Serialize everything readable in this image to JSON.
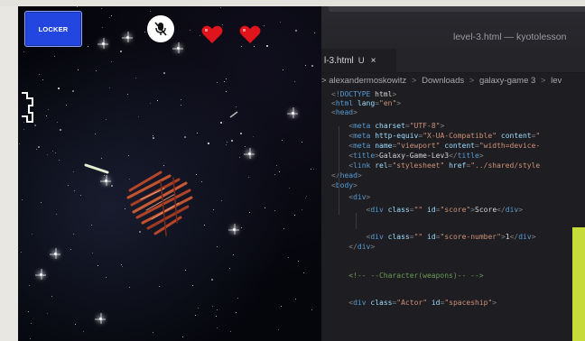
{
  "game": {
    "locker_label": "LOCKER",
    "mic_icon": "microphone-muted-icon",
    "lives": 2,
    "heart_color": "#e0141c",
    "locker_color": "#2346e0"
  },
  "editor": {
    "window_title": "level-3.html — kyotolesson",
    "tab": {
      "label": "l-3.html",
      "status": "U",
      "close": "×"
    },
    "breadcrumb": [
      ">",
      "alexandermoskowitz",
      ">",
      "Downloads",
      ">",
      "galaxy-game 3",
      ">",
      "lev"
    ],
    "code_lines": [
      [
        {
          "t": "punc",
          "v": "<!"
        },
        {
          "t": "tag",
          "v": "DOCTYPE"
        },
        {
          "t": "text",
          "v": " html"
        },
        {
          "t": "punc",
          "v": ">"
        }
      ],
      [
        {
          "t": "punc",
          "v": "<"
        },
        {
          "t": "tag",
          "v": "html"
        },
        {
          "t": "text",
          "v": " "
        },
        {
          "t": "attr",
          "v": "lang"
        },
        {
          "t": "punc",
          "v": "="
        },
        {
          "t": "str",
          "v": "\"en\""
        },
        {
          "t": "punc",
          "v": ">"
        }
      ],
      [
        {
          "t": "punc",
          "v": "<"
        },
        {
          "t": "tag",
          "v": "head"
        },
        {
          "t": "punc",
          "v": ">"
        }
      ],
      [
        {
          "t": "text",
          "v": "    "
        },
        {
          "t": "punc",
          "v": "<"
        },
        {
          "t": "tag",
          "v": "meta"
        },
        {
          "t": "text",
          "v": " "
        },
        {
          "t": "attr",
          "v": "charset"
        },
        {
          "t": "punc",
          "v": "="
        },
        {
          "t": "str",
          "v": "\"UTF-8\""
        },
        {
          "t": "punc",
          "v": ">"
        }
      ],
      [
        {
          "t": "text",
          "v": "    "
        },
        {
          "t": "punc",
          "v": "<"
        },
        {
          "t": "tag",
          "v": "meta"
        },
        {
          "t": "text",
          "v": " "
        },
        {
          "t": "attr",
          "v": "http-equiv"
        },
        {
          "t": "punc",
          "v": "="
        },
        {
          "t": "str",
          "v": "\"X-UA-Compatible\""
        },
        {
          "t": "text",
          "v": " "
        },
        {
          "t": "attr",
          "v": "content"
        },
        {
          "t": "punc",
          "v": "="
        },
        {
          "t": "str",
          "v": "\""
        }
      ],
      [
        {
          "t": "text",
          "v": "    "
        },
        {
          "t": "punc",
          "v": "<"
        },
        {
          "t": "tag",
          "v": "meta"
        },
        {
          "t": "text",
          "v": " "
        },
        {
          "t": "attr",
          "v": "name"
        },
        {
          "t": "punc",
          "v": "="
        },
        {
          "t": "str",
          "v": "\"viewport\""
        },
        {
          "t": "text",
          "v": " "
        },
        {
          "t": "attr",
          "v": "content"
        },
        {
          "t": "punc",
          "v": "="
        },
        {
          "t": "str",
          "v": "\"width=device-"
        }
      ],
      [
        {
          "t": "text",
          "v": "    "
        },
        {
          "t": "punc",
          "v": "<"
        },
        {
          "t": "tag",
          "v": "title"
        },
        {
          "t": "punc",
          "v": ">"
        },
        {
          "t": "text",
          "v": "Galaxy-Game-Lev3"
        },
        {
          "t": "punc",
          "v": "</"
        },
        {
          "t": "tag",
          "v": "title"
        },
        {
          "t": "punc",
          "v": ">"
        }
      ],
      [
        {
          "t": "text",
          "v": "    "
        },
        {
          "t": "punc",
          "v": "<"
        },
        {
          "t": "tag",
          "v": "link"
        },
        {
          "t": "text",
          "v": " "
        },
        {
          "t": "attr",
          "v": "rel"
        },
        {
          "t": "punc",
          "v": "="
        },
        {
          "t": "str",
          "v": "\"stylesheet\""
        },
        {
          "t": "text",
          "v": " "
        },
        {
          "t": "attr",
          "v": "href"
        },
        {
          "t": "punc",
          "v": "="
        },
        {
          "t": "str",
          "v": "\"../shared/style"
        }
      ],
      [
        {
          "t": "punc",
          "v": "</"
        },
        {
          "t": "tag",
          "v": "head"
        },
        {
          "t": "punc",
          "v": ">"
        }
      ],
      [
        {
          "t": "punc",
          "v": "<"
        },
        {
          "t": "tag",
          "v": "body"
        },
        {
          "t": "punc",
          "v": ">"
        }
      ],
      [
        {
          "t": "text",
          "v": "    "
        },
        {
          "t": "punc",
          "v": "<"
        },
        {
          "t": "tag",
          "v": "div"
        },
        {
          "t": "punc",
          "v": ">"
        }
      ],
      [
        {
          "t": "text",
          "v": "        "
        },
        {
          "t": "punc",
          "v": "<"
        },
        {
          "t": "tag",
          "v": "div"
        },
        {
          "t": "text",
          "v": " "
        },
        {
          "t": "attr",
          "v": "class"
        },
        {
          "t": "punc",
          "v": "="
        },
        {
          "t": "str",
          "v": "\"\""
        },
        {
          "t": "text",
          "v": " "
        },
        {
          "t": "attr",
          "v": "id"
        },
        {
          "t": "punc",
          "v": "="
        },
        {
          "t": "str",
          "v": "\"score\""
        },
        {
          "t": "punc",
          "v": ">"
        },
        {
          "t": "text",
          "v": "Score"
        },
        {
          "t": "punc",
          "v": "</"
        },
        {
          "t": "tag",
          "v": "div"
        },
        {
          "t": "punc",
          "v": ">"
        }
      ],
      [],
      [
        {
          "t": "text",
          "v": "        "
        },
        {
          "t": "punc",
          "v": "<"
        },
        {
          "t": "tag",
          "v": "div"
        },
        {
          "t": "text",
          "v": " "
        },
        {
          "t": "attr",
          "v": "class"
        },
        {
          "t": "punc",
          "v": "="
        },
        {
          "t": "str",
          "v": "\"\""
        },
        {
          "t": "text",
          "v": " "
        },
        {
          "t": "attr",
          "v": "id"
        },
        {
          "t": "punc",
          "v": "="
        },
        {
          "t": "str",
          "v": "\"score-number\""
        },
        {
          "t": "punc",
          "v": ">"
        },
        {
          "t": "text",
          "v": "1"
        },
        {
          "t": "punc",
          "v": "</"
        },
        {
          "t": "tag",
          "v": "div"
        },
        {
          "t": "punc",
          "v": ">"
        }
      ],
      [
        {
          "t": "text",
          "v": "    "
        },
        {
          "t": "punc",
          "v": "</"
        },
        {
          "t": "tag",
          "v": "div"
        },
        {
          "t": "punc",
          "v": ">"
        }
      ],
      [],
      [
        {
          "t": "text",
          "v": "    "
        },
        {
          "t": "com",
          "v": "<!-- --Character(weapons)-- -->"
        }
      ],
      [],
      [
        {
          "t": "text",
          "v": "    "
        },
        {
          "t": "punc",
          "v": "<"
        },
        {
          "t": "tag",
          "v": "div"
        },
        {
          "t": "text",
          "v": " "
        },
        {
          "t": "attr",
          "v": "class"
        },
        {
          "t": "punc",
          "v": "="
        },
        {
          "t": "str",
          "v": "\"Actor\""
        },
        {
          "t": "text",
          "v": " "
        },
        {
          "t": "attr",
          "v": "id"
        },
        {
          "t": "punc",
          "v": "="
        },
        {
          "t": "str",
          "v": "\"spaceship\""
        },
        {
          "t": "punc",
          "v": ">"
        }
      ]
    ]
  }
}
